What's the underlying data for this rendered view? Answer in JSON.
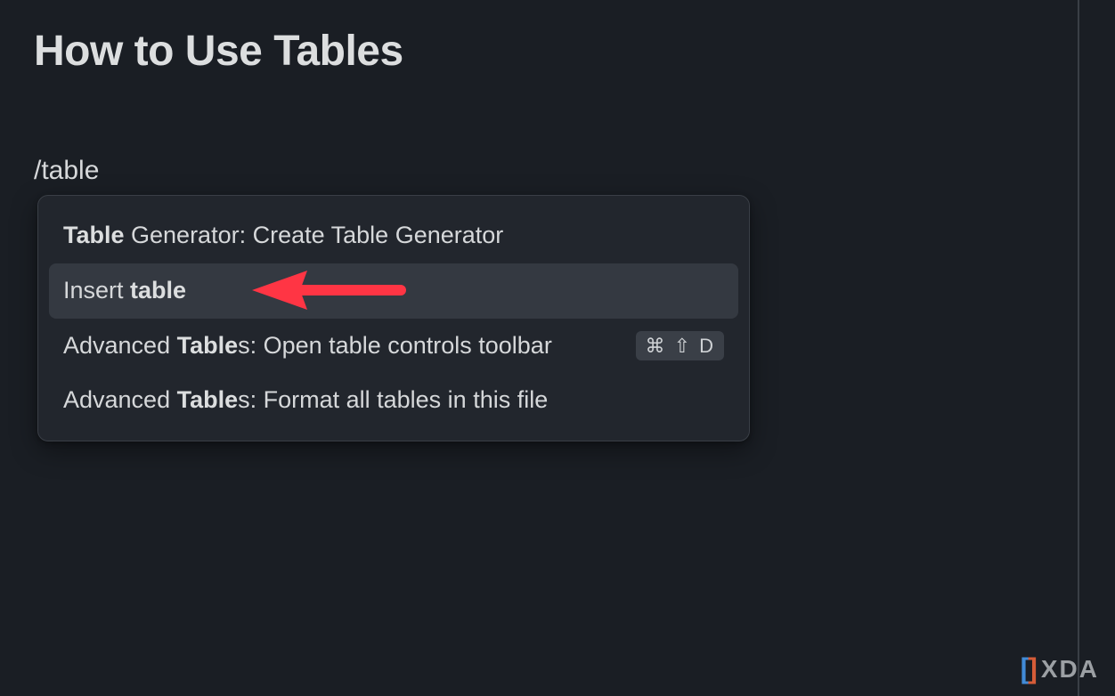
{
  "page": {
    "title": "How to Use Tables",
    "slash_input": "/table"
  },
  "command_menu": {
    "items": [
      {
        "prefix": "",
        "bold1": "Table",
        "mid": " Generator: Create Table Generator",
        "bold2": "",
        "suffix": "",
        "shortcut": "",
        "selected": false
      },
      {
        "prefix": "Insert ",
        "bold1": "table",
        "mid": "",
        "bold2": "",
        "suffix": "",
        "shortcut": "",
        "selected": true
      },
      {
        "prefix": "Advanced ",
        "bold1": "Table",
        "mid": "s: Open table controls toolbar",
        "bold2": "",
        "suffix": "",
        "shortcut": "⌘ ⇧ D",
        "selected": false
      },
      {
        "prefix": "Advanced ",
        "bold1": "Table",
        "mid": "s: Format all tables in this file",
        "bold2": "",
        "suffix": "",
        "shortcut": "",
        "selected": false
      }
    ]
  },
  "annotation": {
    "arrow_color": "#ff3544"
  },
  "watermark": {
    "left_bracket": "[",
    "right_bracket": "]",
    "text": "XDA"
  }
}
